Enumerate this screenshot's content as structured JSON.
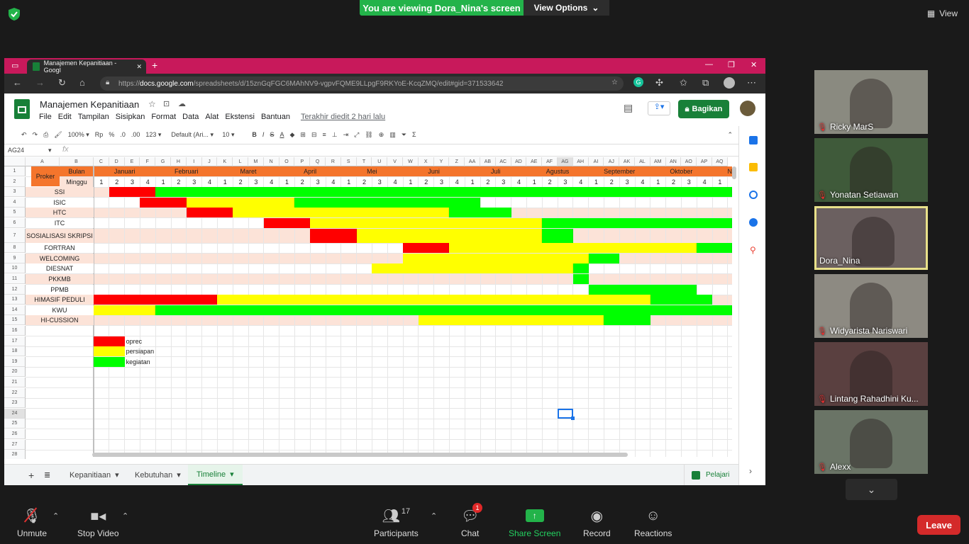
{
  "zoom": {
    "banner": "You are viewing Dora_Nina's screen",
    "view_options": "View Options",
    "view_label": "View",
    "participants": [
      {
        "name": "Ricky MarS",
        "muted": true
      },
      {
        "name": "Yonatan Setiawan",
        "muted": true
      },
      {
        "name": "Dora_Nina",
        "muted": false
      },
      {
        "name": "Widyarista Nariswari",
        "muted": true
      },
      {
        "name": "Lintang Rahadhini Ku...",
        "muted": true
      },
      {
        "name": "Alexx",
        "muted": true
      }
    ],
    "controls": {
      "unmute": "Unmute",
      "stop_video": "Stop Video",
      "participants": "Participants",
      "participants_count": "17",
      "chat": "Chat",
      "chat_badge": "1",
      "share_screen": "Share Screen",
      "record": "Record",
      "reactions": "Reactions",
      "leave": "Leave"
    }
  },
  "browser": {
    "tab_title": "Manajemen Kepanitiaan - Googl",
    "url_prefix": "https://",
    "url_domain": "docs.google.com",
    "url_rest": "/spreadsheets/d/15znGqFGC6MAhNV9-vgpvFQME9LLpgF9RKYoE-KcqZMQ/edit#gid=371533642"
  },
  "sheets": {
    "doc_title": "Manajemen Kepanitiaan",
    "menus": [
      "File",
      "Edit",
      "Tampilan",
      "Sisipkan",
      "Format",
      "Data",
      "Alat",
      "Ekstensi",
      "Bantuan"
    ],
    "last_edit": "Terakhir diedit 2 hari lalu",
    "share": "Bagikan",
    "toolbar": {
      "zoom": "100%",
      "currency": "Rp",
      "percent": "%",
      "dec1": ".0",
      "dec2": ".00",
      "numfmt": "123",
      "font": "Default (Ari...",
      "size": "10"
    },
    "name_box": "AG24",
    "sheet_tabs": [
      "Kepanitiaan",
      "Kebutuhan",
      "Timeline"
    ],
    "active_tab": "Timeline",
    "pelajari": "Pelajari",
    "col_headers": [
      "A",
      "B",
      "C",
      "D",
      "E",
      "F",
      "G",
      "H",
      "I",
      "J",
      "K",
      "L",
      "M",
      "N",
      "O",
      "P",
      "Q",
      "R",
      "S",
      "T",
      "U",
      "V",
      "W",
      "X",
      "Y",
      "Z",
      "AA",
      "AB",
      "AC",
      "AD",
      "AE",
      "AF",
      "AG",
      "AH",
      "AI",
      "AJ",
      "AK",
      "AL",
      "AM",
      "AN",
      "AO",
      "AP",
      "AQ"
    ],
    "row_headers": [
      "1",
      "2",
      "3",
      "4",
      "5",
      "6",
      "7",
      "8",
      "9",
      "10",
      "11",
      "12",
      "13",
      "14",
      "15",
      "16",
      "17",
      "18",
      "19",
      "20",
      "21",
      "22",
      "23",
      "24",
      "25",
      "26",
      "27",
      "28"
    ],
    "header_proker": "Proker",
    "header_bulan": "Bulan",
    "header_minggu": "Minggu",
    "months": [
      "Januari",
      "Februari",
      "Maret",
      "April",
      "Mei",
      "Juni",
      "Juli",
      "Agustus",
      "September",
      "Oktober",
      "N"
    ],
    "weeks": [
      "1",
      "2",
      "3",
      "4",
      "1",
      "2",
      "3",
      "4",
      "1",
      "2",
      "3",
      "4",
      "1",
      "2",
      "3",
      "4",
      "1",
      "2",
      "3",
      "4",
      "1",
      "2",
      "3",
      "4",
      "1",
      "2",
      "3",
      "4",
      "1",
      "2",
      "3",
      "4",
      "1",
      "2",
      "3",
      "4",
      "1",
      "2",
      "3",
      "4",
      "1"
    ],
    "programs": [
      "SSI",
      "ISIC",
      "HTC",
      "ITC",
      "SOSIALISASI SKRIPSI",
      "FORTRAN",
      "WELCOMING",
      "DIESNAT",
      "PKKMB",
      "PPMB",
      "HIMASIF PEDULI",
      "KWU",
      "HI-CUSSION"
    ],
    "legend": [
      {
        "color": "#ff0000",
        "label": "oprec"
      },
      {
        "color": "#ffff00",
        "label": "persiapan"
      },
      {
        "color": "#00ff00",
        "label": "kegiatan"
      }
    ],
    "timeline": [
      [
        [
          "r",
          1,
          3
        ],
        [
          "g",
          4,
          41
        ]
      ],
      [
        [
          "r",
          3,
          5
        ],
        [
          "y",
          6,
          12
        ],
        [
          "g",
          13,
          24
        ]
      ],
      [
        [
          "r",
          6,
          8
        ],
        [
          "y",
          9,
          22
        ],
        [
          "g",
          23,
          26
        ]
      ],
      [
        [
          "r",
          11,
          13
        ],
        [
          "y",
          14,
          28
        ],
        [
          "g",
          29,
          41
        ]
      ],
      [
        [
          "r",
          14,
          16
        ],
        [
          "y",
          17,
          28
        ],
        [
          "g",
          29,
          30
        ]
      ],
      [
        [
          "r",
          20,
          22
        ],
        [
          "y",
          23,
          38
        ],
        [
          "g",
          39,
          41
        ]
      ],
      [
        [
          "y",
          20,
          31
        ],
        [
          "g",
          32,
          33
        ]
      ],
      [
        [
          "y",
          18,
          30
        ],
        [
          "g",
          31,
          31
        ]
      ],
      [
        [
          "g",
          31,
          31
        ]
      ],
      [
        [
          "g",
          32,
          38
        ]
      ],
      [
        [
          "r",
          0,
          7
        ],
        [
          "y",
          8,
          35
        ],
        [
          "g",
          36,
          39
        ]
      ],
      [
        [
          "y",
          0,
          3
        ],
        [
          "g",
          4,
          41
        ]
      ],
      [
        [
          "y",
          21,
          32
        ],
        [
          "g",
          33,
          35
        ]
      ]
    ]
  }
}
